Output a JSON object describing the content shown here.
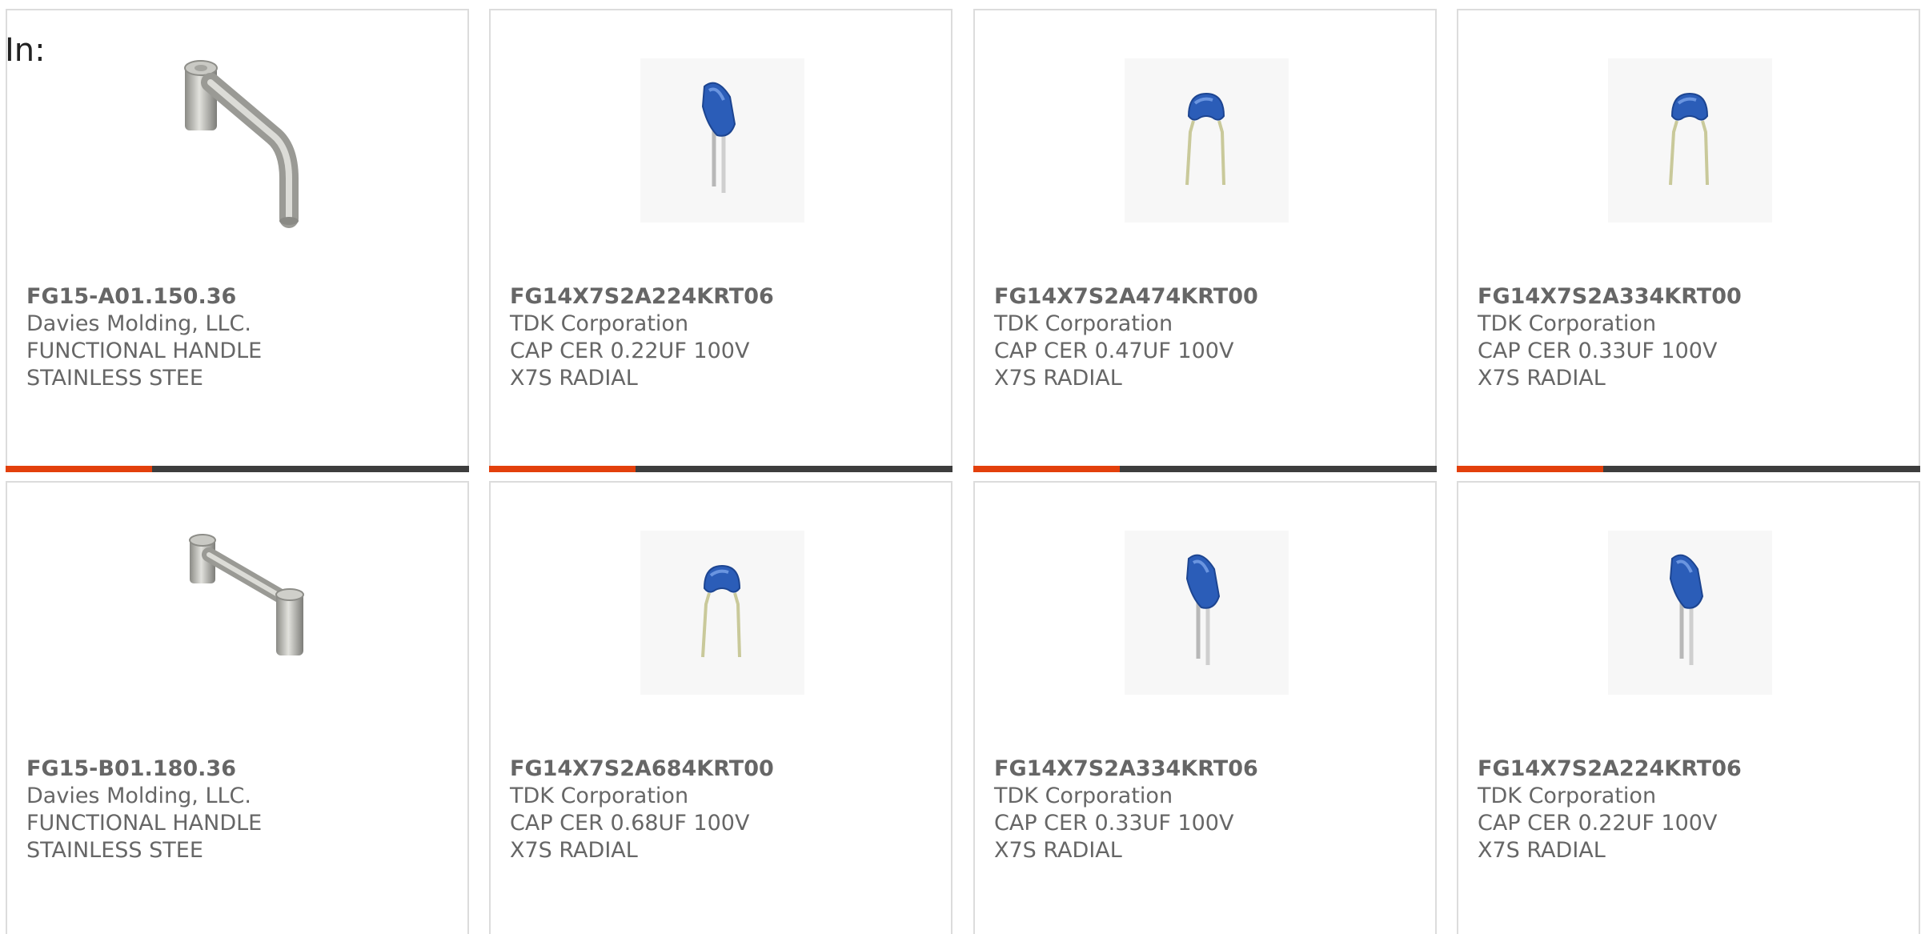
{
  "heading": "In:",
  "colors": {
    "accent": "#e3400c",
    "bar": "#3d3d3d",
    "text": "#666666",
    "border": "#dcdcdc"
  },
  "products": [
    {
      "part_number": "FG15-A01.150.36",
      "manufacturer": "Davies Molding, LLC.",
      "description": "FUNCTIONAL HANDLE STAINLESS STEE",
      "image": "handle-offset-icon"
    },
    {
      "part_number": "FG14X7S2A224KRT06",
      "manufacturer": "TDK Corporation",
      "description": "CAP CER 0.22UF 100V X7S RADIAL",
      "image": "capacitor-side-icon"
    },
    {
      "part_number": "FG14X7S2A474KRT00",
      "manufacturer": "TDK Corporation",
      "description": "CAP CER 0.47UF 100V X7S RADIAL",
      "image": "capacitor-front-icon"
    },
    {
      "part_number": "FG14X7S2A334KRT00",
      "manufacturer": "TDK Corporation",
      "description": "CAP CER 0.33UF 100V X7S RADIAL",
      "image": "capacitor-front-icon"
    },
    {
      "part_number": "FG15-B01.180.36",
      "manufacturer": "Davies Molding, LLC.",
      "description": "FUNCTIONAL HANDLE STAINLESS STEE",
      "image": "handle-straight-icon"
    },
    {
      "part_number": "FG14X7S2A684KRT00",
      "manufacturer": "TDK Corporation",
      "description": "CAP CER 0.68UF 100V X7S RADIAL",
      "image": "capacitor-front-icon"
    },
    {
      "part_number": "FG14X7S2A334KRT06",
      "manufacturer": "TDK Corporation",
      "description": "CAP CER 0.33UF 100V X7S RADIAL",
      "image": "capacitor-side-icon"
    },
    {
      "part_number": "FG14X7S2A224KRT06",
      "manufacturer": "TDK Corporation",
      "description": "CAP CER 0.22UF 100V X7S RADIAL",
      "image": "capacitor-side-icon"
    }
  ]
}
